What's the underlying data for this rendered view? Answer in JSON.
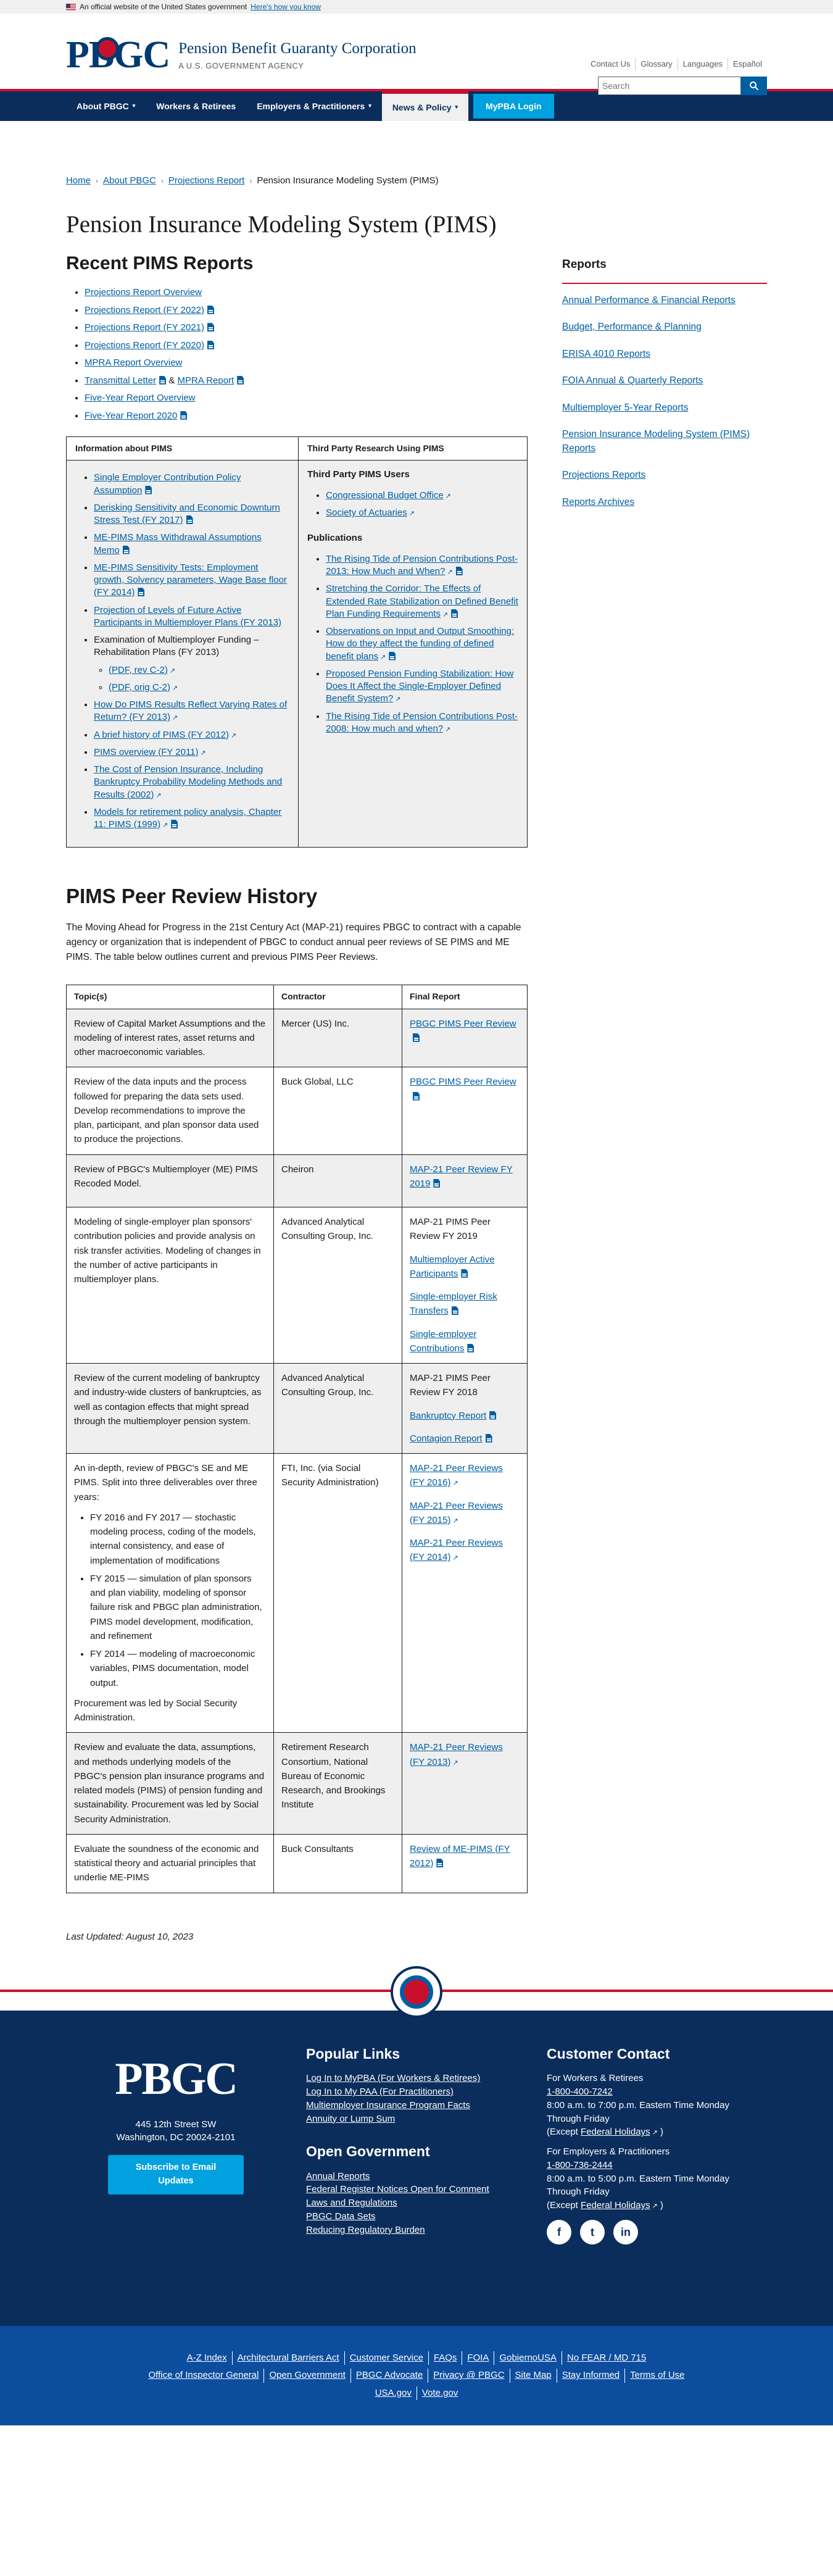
{
  "gov_banner": {
    "text": "An official website of the United States government",
    "link": "Here's how you know"
  },
  "header": {
    "logo": "PBGC",
    "agency_name": "Pension Benefit Guaranty Corporation",
    "agency_sub": "A U.S. GOVERNMENT AGENCY",
    "util_links": [
      "Contact Us",
      "Glossary",
      "Languages",
      "Español"
    ],
    "search_placeholder": "Search"
  },
  "nav": [
    {
      "label": "About PBGC",
      "caret": true,
      "active": false
    },
    {
      "label": "Workers & Retirees",
      "caret": false,
      "active": false
    },
    {
      "label": "Employers & Practitioners",
      "caret": true,
      "active": false
    },
    {
      "label": "News & Policy",
      "caret": true,
      "active": true
    },
    {
      "label": "MyPBA Login",
      "caret": false,
      "active": false,
      "login": true
    }
  ],
  "breadcrumb": [
    "Home",
    "About PBGC",
    "Projections Report",
    "Pension Insurance Modeling System (PIMS)"
  ],
  "page_title": "Pension Insurance Modeling System (PIMS)",
  "recent": {
    "title": "Recent PIMS Reports",
    "items": [
      {
        "text": "Projections Report Overview",
        "pdf": false
      },
      {
        "text": "Projections Report (FY 2022)",
        "pdf": true
      },
      {
        "text": "Projections Report (FY 2021)",
        "pdf": true
      },
      {
        "text": "Projections Report (FY 2020)",
        "pdf": true
      },
      {
        "text": "MPRA Report Overview",
        "pdf": false
      },
      {
        "text": "Transmittal Letter",
        "pdf": true,
        "amp": "&",
        "text2": "MPRA Report"
      },
      {
        "text": "Five-Year Report Overview",
        "pdf": false
      },
      {
        "text": "Five-Year Report 2020",
        "pdf": true
      }
    ]
  },
  "info_table": {
    "col1_header": "Information about PIMS",
    "col2_header": "Third Party Research Using PIMS",
    "col1_items": [
      {
        "text": "Single Employer Contribution Policy Assumption",
        "link": true,
        "pdf": true
      },
      {
        "text": "Derisking Sensitivity and Economic Downturn Stress Test (FY 2017)",
        "link": true,
        "pdf": true
      },
      {
        "text": "ME-PIMS Mass Withdrawal Assumptions Memo",
        "link": true,
        "pdf": true
      },
      {
        "text": "ME-PIMS Sensitivity Tests: Employment growth, Solvency parameters, Wage Base floor (FY 2014)",
        "link": true,
        "pdf": true
      },
      {
        "text": "Projection of Levels of Future Active Participants in Multiemployer Plans (FY 2013)",
        "link": true,
        "pdf": false
      },
      {
        "text": "Examination of Multiemployer Funding – Rehabilitation Plans (FY 2013)",
        "link": false,
        "pdf": false,
        "sub": [
          "(PDF, rev C-2)",
          "(PDF, orig C-2)"
        ]
      },
      {
        "text": "How Do PIMS Results Reflect Varying Rates of Return? (FY 2013)",
        "link": true,
        "pdf": false
      },
      {
        "text": "A brief history of PIMS (FY 2012)",
        "link": true,
        "pdf": false
      },
      {
        "text": "PIMS overview (FY 2011)",
        "link": true,
        "pdf": false
      },
      {
        "text": "The Cost of Pension Insurance, Including Bankruptcy Probability Modeling Methods and Results (2002)",
        "link": true,
        "pdf": false
      },
      {
        "text": "Models for retirement policy analysis, Chapter 11: PIMS (1999)",
        "link": true,
        "pdf": true
      }
    ],
    "col2_users_title": "Third Party PIMS Users",
    "col2_users": [
      "Congressional Budget Office",
      "Society of Actuaries"
    ],
    "col2_pubs_title": "Publications",
    "col2_pubs": [
      {
        "text": "The Rising Tide of Pension Contributions Post-2013: How Much and When?",
        "pdf": true
      },
      {
        "text": "Stretching the Corridor: The Effects of Extended Rate Stabilization on Defined Benefit Plan Funding Requirements",
        "pdf": true
      },
      {
        "text": "Observations on Input and Output Smoothing: How do they affect the funding of defined benefit plans",
        "pdf": true
      },
      {
        "text": "Proposed Pension Funding Stabilization: How Does It Affect the Single-Employer Defined Benefit System?",
        "pdf": false
      },
      {
        "text": "The Rising Tide of Pension Contributions Post-2008: How much and when?",
        "pdf": false
      }
    ]
  },
  "peer": {
    "title": "PIMS Peer Review History",
    "intro": "The Moving Ahead for Progress in the 21st Century Act (MAP-21) requires PBGC to contract with a capable agency or organization that is independent of PBGC to conduct annual peer reviews of SE PIMS and ME PIMS. The table below outlines current and previous PIMS Peer Reviews.",
    "headers": [
      "Topic(s)",
      "Contractor",
      "Final Report"
    ],
    "rows": [
      {
        "topic": "Review of Capital Market Assumptions and the modeling of interest rates, asset returns and other macroeconomic variables.",
        "contractor": "Mercer (US) Inc.",
        "reports": [
          {
            "text": "PBGC PIMS Peer Review",
            "link": true,
            "pdf": true
          }
        ]
      },
      {
        "topic": "Review of the data inputs and the process followed for preparing the data sets used. Develop recommendations to improve the plan, participant, and plan sponsor data used to produce the projections.",
        "contractor": "Buck Global, LLC",
        "reports": [
          {
            "text": "PBGC PIMS Peer Review",
            "link": true,
            "pdf": true
          }
        ]
      },
      {
        "topic": "Review of PBGC's Multiemployer (ME) PIMS Recoded Model.",
        "contractor": "Cheiron",
        "reports": [
          {
            "text": "MAP-21 Peer Review FY 2019",
            "link": true,
            "pdf": true
          }
        ]
      },
      {
        "topic": "Modeling of single-employer plan sponsors' contribution policies and provide analysis on risk transfer activities. Modeling of changes in the number of active participants in multiemployer plans.",
        "contractor": "Advanced Analytical Consulting Group, Inc.",
        "reports": [
          {
            "text": "MAP-21 PIMS Peer Review FY 2019",
            "link": false,
            "pdf": false
          },
          {
            "text": "Multiemployer Active Participants",
            "link": true,
            "pdf": true
          },
          {
            "text": "Single-employer Risk Transfers",
            "link": true,
            "pdf": true
          },
          {
            "text": "Single-employer Contributions",
            "link": true,
            "pdf": true
          }
        ]
      },
      {
        "topic": "Review of the current modeling of bankruptcy and industry-wide clusters of bankruptcies, as well as contagion effects that might spread through the multiemployer pension system.",
        "contractor": "Advanced Analytical Consulting Group, Inc.",
        "reports": [
          {
            "text": "MAP-21 PIMS Peer Review FY 2018",
            "link": false,
            "pdf": false
          },
          {
            "text": "Bankruptcy Report",
            "link": true,
            "pdf": true
          },
          {
            "text": "Contagion Report",
            "link": true,
            "pdf": true
          }
        ]
      },
      {
        "topic": "An in-depth, review of PBGC's SE and ME PIMS. Split into three deliverables over three years:",
        "bullets": [
          "FY 2016 and FY 2017 — stochastic modeling process, coding of the models, internal consistency, and ease of implementation of modifications",
          "FY 2015 — simulation of plan sponsors and plan viability, modeling of sponsor failure risk and PBGC plan administration, PIMS model development, modification, and refinement",
          "FY 2014 — modeling of macroeconomic variables, PIMS documentation, model output."
        ],
        "topic_after": "Procurement was led by Social Security Administration.",
        "contractor": "FTI, Inc. (via Social Security Administration)",
        "reports": [
          {
            "text": "MAP-21 Peer Reviews (FY 2016)",
            "link": true,
            "pdf": false
          },
          {
            "text": "MAP-21 Peer Reviews (FY 2015)",
            "link": true,
            "pdf": false
          },
          {
            "text": "MAP-21 Peer Reviews (FY 2014)",
            "link": true,
            "pdf": false
          }
        ]
      },
      {
        "topic": "Review and evaluate the data, assumptions, and methods underlying models of the PBGC's pension plan insurance programs and related models (PIMS) of pension funding and sustainability. Procurement was led by Social Security Administration.",
        "contractor": "Retirement Research Consortium, National Bureau of Economic Research, and Brookings Institute",
        "reports": [
          {
            "text": "MAP-21 Peer Reviews (FY 2013)",
            "link": true,
            "pdf": false
          }
        ]
      },
      {
        "topic": "Evaluate the soundness of the economic and statistical theory and actuarial principles that underlie ME-PIMS",
        "contractor": "Buck Consultants",
        "reports": [
          {
            "text": "Review of ME-PIMS (FY 2012)",
            "link": true,
            "pdf": true
          }
        ]
      }
    ]
  },
  "last_updated": "Last Updated: August 10, 2023",
  "sidebar": {
    "title": "Reports",
    "items": [
      "Annual Performance & Financial Reports",
      "Budget, Performance & Planning",
      "ERISA 4010 Reports",
      "FOIA Annual & Quarterly Reports",
      "Multiemployer 5-Year Reports",
      "Pension Insurance Modeling System (PIMS) Reports",
      "Projections Reports",
      "Reports Archives"
    ]
  },
  "footer": {
    "logo": "PBGC",
    "address_line1": "445 12th Street SW",
    "address_line2": "Washington, DC 20024-2101",
    "subscribe": "Subscribe to Email Updates",
    "popular_title": "Popular Links",
    "popular": [
      "Log In to MyPBA (For Workers & Retirees)",
      "Log In to My PAA (For Practitioners)",
      "Multiemployer Insurance Program Facts",
      "Annuity or Lump Sum"
    ],
    "open_title": "Open Government",
    "open": [
      "Annual Reports",
      "Federal Register Notices Open for Comment",
      "Laws and Regulations",
      "PBGC Data Sets",
      "Reducing Regulatory Burden"
    ],
    "contact_title": "Customer Contact",
    "workers_label": "For Workers & Retirees",
    "workers_phone": "1-800-400-7242",
    "workers_hours": "8:00 a.m. to 7:00 p.m. Eastern Time Monday Through Friday",
    "except_label": "(Except",
    "holidays_link": "Federal Holidays",
    "except_close": ")",
    "employers_label": "For Employers & Practitioners",
    "employers_phone": "1-800-736-2444",
    "employers_hours": "8:00 a.m. to 5:00 p.m. Eastern Time Monday Through Friday",
    "social": [
      "f",
      "t",
      "in"
    ],
    "bottom_row1": [
      "A-Z Index",
      "Architectural Barriers Act",
      "Customer Service",
      "FAQs",
      "FOIA",
      "GobiernoUSA",
      "No FEAR / MD 715"
    ],
    "bottom_row2": [
      "Office of Inspector General",
      "Open Government",
      "PBGC Advocate",
      "Privacy @ PBGC",
      "Site Map",
      "Stay Informed",
      "Terms of Use"
    ],
    "bottom_row3": [
      "USA.gov",
      "Vote.gov"
    ]
  }
}
